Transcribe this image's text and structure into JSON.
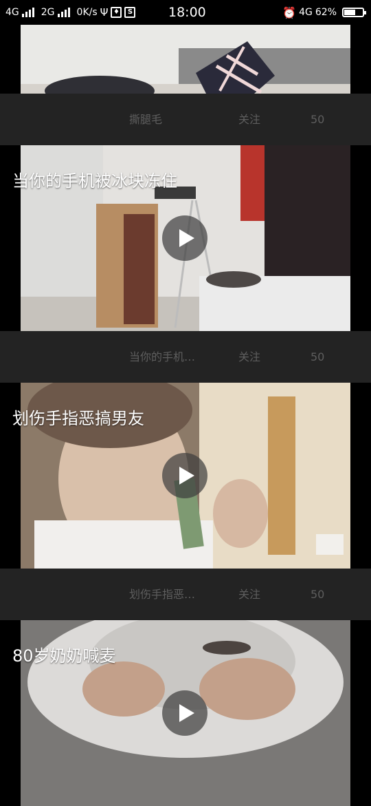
{
  "status_bar": {
    "net1": "4G",
    "net2": "2G",
    "speed": "0K/s",
    "time": "18:00",
    "net3": "4G",
    "battery": "62%",
    "battery_level": 0.62
  },
  "feed": [
    {
      "title": "",
      "bar_title": "撕腿毛",
      "follow_label": "关注",
      "count": "50"
    },
    {
      "title": "当你的手机被冰块冻住",
      "bar_title": "当你的手机…",
      "follow_label": "关注",
      "count": "50"
    },
    {
      "title": "划伤手指恶搞男友",
      "bar_title": "划伤手指恶…",
      "follow_label": "关注",
      "count": "50"
    },
    {
      "title": "80岁奶奶喊麦"
    }
  ]
}
